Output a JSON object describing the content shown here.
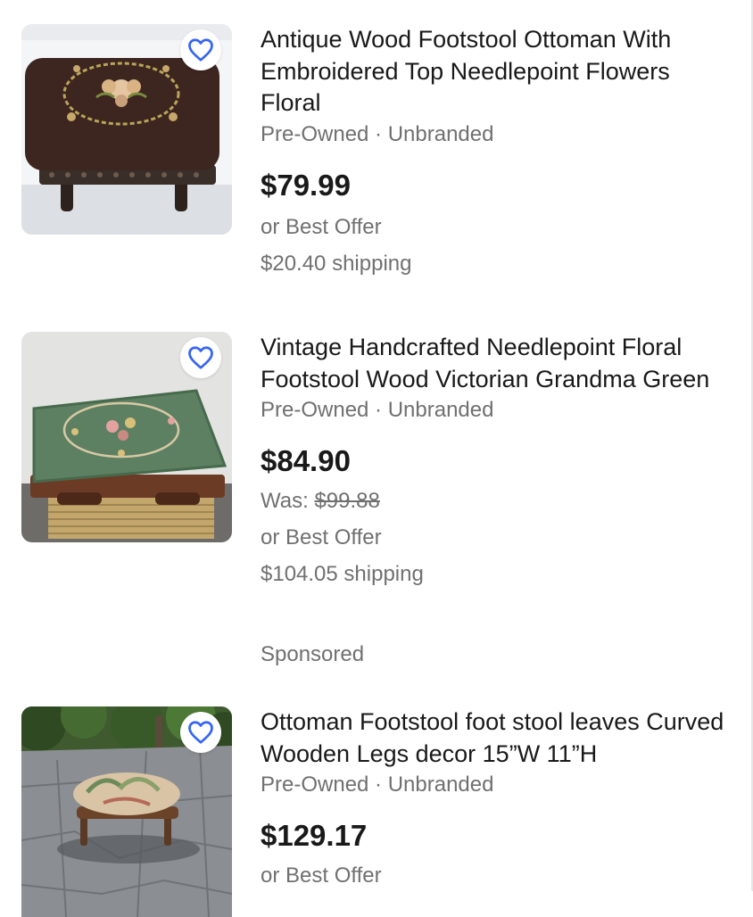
{
  "listings": [
    {
      "title": "Antique Wood Footstool Ottoman With Embroidered Top Needlepoint Flowers Floral",
      "subtitle": "Pre-Owned · Unbranded",
      "price": "$79.99",
      "was_label": "",
      "was_price": "",
      "best_offer": "or Best Offer",
      "shipping": "$20.40 shipping",
      "image_desc": "dark brown needlepoint footstool with floral embroidery"
    },
    {
      "title": "Vintage Handcrafted Needlepoint Floral Footstool Wood Victorian Grandma Green",
      "subtitle": "Pre-Owned · Unbranded",
      "price": "$84.90",
      "was_label": "Was: ",
      "was_price": "$99.88",
      "best_offer": "or Best Offer",
      "shipping": "$104.05 shipping",
      "sponsored": "Sponsored",
      "image_desc": "green needlepoint footstool on wicker"
    },
    {
      "title": "Ottoman Footstool foot stool leaves Curved Wooden Legs decor 15”W 11”H",
      "subtitle": "Pre-Owned · Unbranded",
      "price": "$129.17",
      "best_offer": "or Best Offer",
      "image_desc": "leaf-print ottoman on stone patio outdoors"
    }
  ],
  "icons": {
    "watch": "heart-outline-icon"
  },
  "colors": {
    "heart": "#3665f3",
    "text_primary": "#191919",
    "text_secondary": "#707070"
  }
}
